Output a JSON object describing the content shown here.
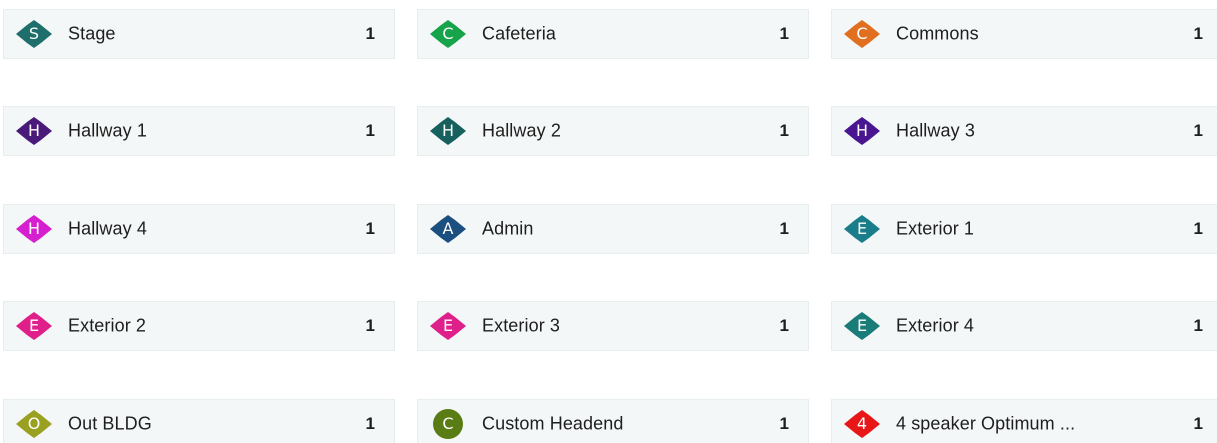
{
  "zones": [
    {
      "label": "Stage",
      "count": "1",
      "letter": "S",
      "shape": "diamond",
      "color": "#1e6f6b"
    },
    {
      "label": "Cafeteria",
      "count": "1",
      "letter": "C",
      "shape": "diamond",
      "color": "#16a34a"
    },
    {
      "label": "Commons",
      "count": "1",
      "letter": "C",
      "shape": "diamond",
      "color": "#e07020"
    },
    {
      "label": "Hallway 1",
      "count": "1",
      "letter": "H",
      "shape": "diamond",
      "color": "#4a1a7a"
    },
    {
      "label": "Hallway 2",
      "count": "1",
      "letter": "H",
      "shape": "diamond",
      "color": "#16605e"
    },
    {
      "label": "Hallway 3",
      "count": "1",
      "letter": "H",
      "shape": "diamond",
      "color": "#4a1590"
    },
    {
      "label": "Hallway 4",
      "count": "1",
      "letter": "H",
      "shape": "diamond",
      "color": "#d61fcf"
    },
    {
      "label": "Admin",
      "count": "1",
      "letter": "A",
      "shape": "diamond",
      "color": "#1a4f80"
    },
    {
      "label": "Exterior 1",
      "count": "1",
      "letter": "E",
      "shape": "diamond",
      "color": "#1a7e8a"
    },
    {
      "label": "Exterior 2",
      "count": "1",
      "letter": "E",
      "shape": "diamond",
      "color": "#e0208a"
    },
    {
      "label": "Exterior 3",
      "count": "1",
      "letter": "E",
      "shape": "diamond",
      "color": "#e0208a"
    },
    {
      "label": "Exterior 4",
      "count": "1",
      "letter": "E",
      "shape": "diamond",
      "color": "#1a7c78"
    },
    {
      "label": "Out BLDG",
      "count": "1",
      "letter": "O",
      "shape": "diamond",
      "color": "#9aa020"
    },
    {
      "label": "Custom Headend",
      "count": "1",
      "letter": "C",
      "shape": "circle",
      "color": "#5a7c14"
    },
    {
      "label": "4 speaker Optimum ...",
      "count": "1",
      "letter": "4",
      "shape": "diamond",
      "color": "#e81616"
    }
  ]
}
